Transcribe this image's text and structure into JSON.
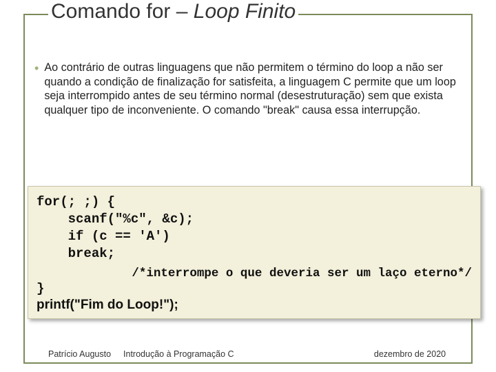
{
  "title": {
    "part1": "Comando for – ",
    "part2": "Loop Finito"
  },
  "bullet": "•",
  "paragraph": "Ao contrário de outras linguagens que não permitem o término do loop a não ser quando a condição de finalização for satisfeita, a linguagem C permite que um loop seja interrompido antes de seu término normal (desestruturação) sem que exista qualquer tipo de inconveniente. O comando \"break\" causa essa interrupção.",
  "code": {
    "l1": "for(; ;) {",
    "l2": "    scanf(\"%c\", &c);",
    "l3": "    if (c == 'A')",
    "l4": "    break;",
    "comment": "/*interrompe o que deveria ser um laço eterno*/",
    "l5": "}",
    "l6": "printf(\"Fim do Loop!\");"
  },
  "footer": {
    "author": "Patrício Augusto",
    "course": "Introdução à Programação C",
    "date": "dezembro de 2020"
  }
}
